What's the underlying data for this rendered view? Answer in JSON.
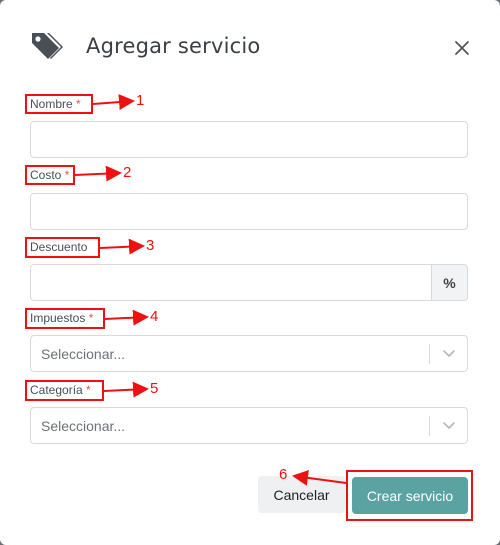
{
  "dialog": {
    "title": "Agregar servicio",
    "close_icon": "close-icon",
    "header_icon": "tags-icon"
  },
  "fields": {
    "nombre": {
      "label": "Nombre",
      "required_mark": "*",
      "value": ""
    },
    "costo": {
      "label": "Costo",
      "required_mark": "*",
      "value": ""
    },
    "descuento": {
      "label": "Descuento",
      "value": "",
      "addon": "%"
    },
    "impuestos": {
      "label": "Impuestos",
      "required_mark": "*",
      "placeholder": "Seleccionar..."
    },
    "categoria": {
      "label": "Categoría",
      "required_mark": "*",
      "placeholder": "Seleccionar..."
    }
  },
  "buttons": {
    "cancel_label": "Cancelar",
    "create_label": "Crear servicio"
  },
  "annotations": [
    "1",
    "2",
    "3",
    "4",
    "5",
    "6"
  ],
  "colors": {
    "primary": "#5ba3a3",
    "required": "#e0554c",
    "annotation": "#ee1111"
  }
}
